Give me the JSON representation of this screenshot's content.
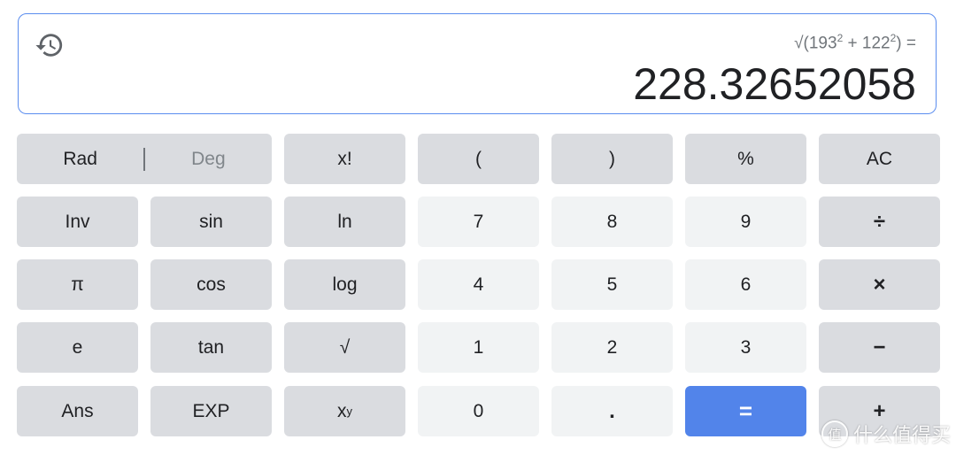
{
  "display": {
    "history_icon": "history-icon",
    "expression_prefix": "√(193",
    "expression_exp1": "2",
    "expression_mid": " + 122",
    "expression_exp2": "2",
    "expression_suffix": ") =",
    "result": "228.32652058"
  },
  "angle_mode": {
    "rad_label": "Rad",
    "deg_label": "Deg",
    "selected": "Rad"
  },
  "keys": {
    "factorial": "x!",
    "open_paren": "(",
    "close_paren": ")",
    "percent": "%",
    "clear": "AC",
    "inv": "Inv",
    "sin": "sin",
    "ln": "ln",
    "seven": "7",
    "eight": "8",
    "nine": "9",
    "divide": "÷",
    "pi": "π",
    "cos": "cos",
    "log": "log",
    "four": "4",
    "five": "5",
    "six": "6",
    "multiply": "×",
    "e": "e",
    "tan": "tan",
    "sqrt": "√",
    "one": "1",
    "two": "2",
    "three": "3",
    "minus": "−",
    "ans": "Ans",
    "exp": "EXP",
    "power_base": "x",
    "power_exp": "y",
    "zero": "0",
    "decimal": ".",
    "equals": "=",
    "plus": "+"
  },
  "colors": {
    "accent": "#5284ea",
    "function_key": "#dadce0",
    "number_key": "#f1f3f4",
    "display_border": "#5b8def"
  },
  "watermark": {
    "logo_char": "值",
    "text": "什么值得买"
  }
}
